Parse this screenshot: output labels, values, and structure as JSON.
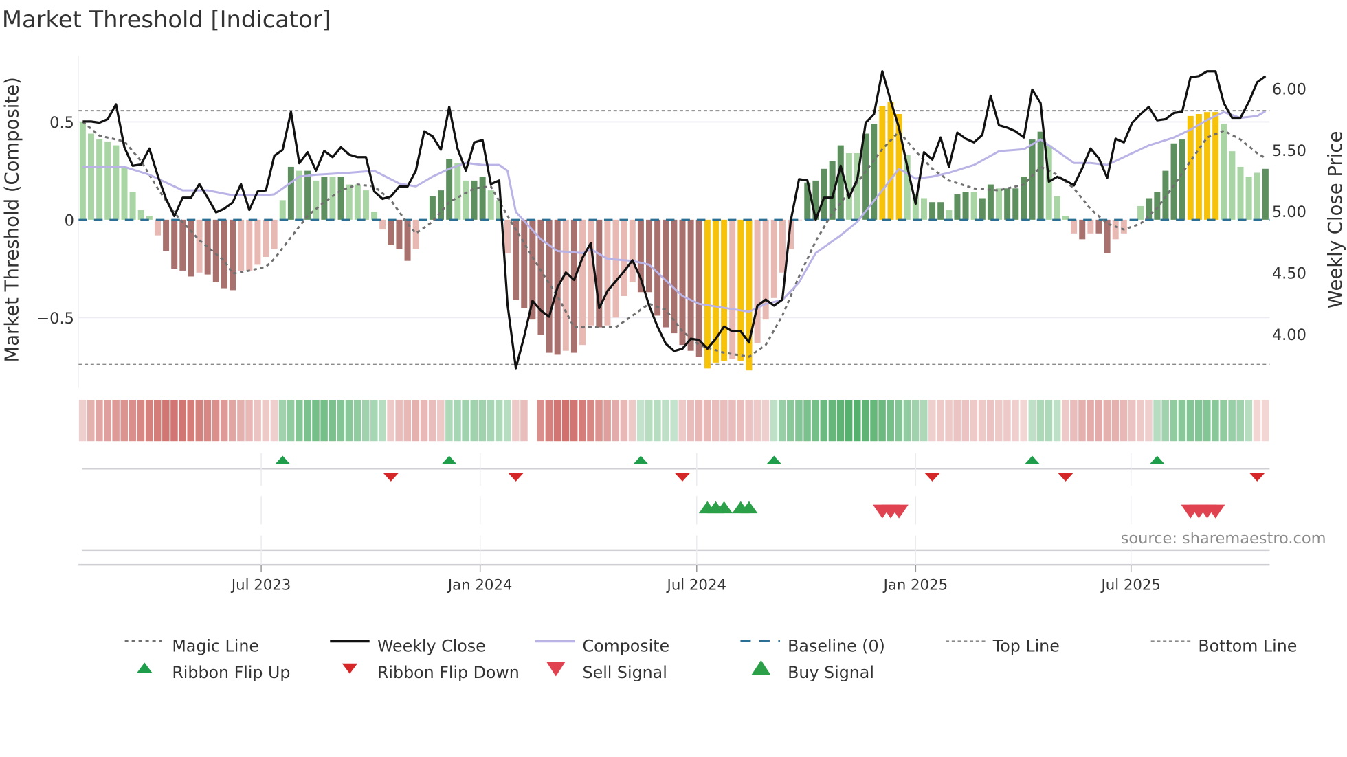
{
  "title": "Market Threshold [Indicator]",
  "source": "source: sharemaestro.com",
  "chart_data": {
    "type": "bar",
    "title": "Market Threshold [Indicator]",
    "ylabel": "Market Threshold (Composite)",
    "ylabel_right": "Weekly Close Price",
    "x_start_date": "2023-02-01",
    "x_step_days": 7,
    "ylim": [
      -0.83,
      0.84
    ],
    "ylim_right": [
      3.6,
      6.3
    ],
    "top_line": 0.557,
    "bottom_line": -0.74,
    "baseline": 0,
    "grid": true,
    "legend_position": "bottom",
    "left_ticks": [
      {
        "v": 0.5,
        "label": "0.5"
      },
      {
        "v": 0,
        "label": "0"
      },
      {
        "v": -0.5,
        "label": "−0.5"
      }
    ],
    "right_ticks": [
      {
        "v": 6.0,
        "label": "6.00"
      },
      {
        "v": 5.5,
        "label": "5.50"
      },
      {
        "v": 5.0,
        "label": "5.00"
      },
      {
        "v": 4.5,
        "label": "4.50"
      },
      {
        "v": 4.0,
        "label": "4.00"
      }
    ],
    "x_ticks": [
      {
        "label": "Jul 2023",
        "date": "2023-07-01"
      },
      {
        "label": "Jan 2024",
        "date": "2024-01-01"
      },
      {
        "label": "Jul 2024",
        "date": "2024-07-01"
      },
      {
        "label": "Jan 2025",
        "date": "2025-01-01"
      },
      {
        "label": "Jul 2025",
        "date": "2025-07-01"
      }
    ],
    "colors": {
      "L": "#a8d5a3",
      "D": "#5e8f5e",
      "l": "#e8b8b3",
      "d": "#a8716d",
      "Y": "#f7c20a",
      "close": "#111111",
      "composite": "#b9b3e6",
      "magic": "#707070",
      "baseline": "#2b6f94",
      "refline": "#8a8a8a",
      "ribbon_green": "#34a050",
      "ribbon_red": "#c85a55",
      "flip_up": "#1e9e4a",
      "flip_down": "#d62728",
      "buy": "#2ca048",
      "sell": "#e0434f"
    },
    "histogram": {
      "category_codes": "LLLLLLLLLlddddlddddlllllLDLDLDLDLLLLldddlLDDDLLDDLLlddddddldlldllllddddddddYYYlYYllllllDDDDDLLDDYYYLLLDDLDDLDDLDDDDDLLLldlddllLLDDDDDYYYYLLLLLD",
      "values": [
        0.5,
        0.44,
        0.41,
        0.4,
        0.38,
        0.27,
        0.14,
        0.05,
        0.02,
        -0.08,
        -0.16,
        -0.25,
        -0.26,
        -0.29,
        -0.27,
        -0.28,
        -0.32,
        -0.35,
        -0.36,
        -0.26,
        -0.26,
        -0.23,
        -0.19,
        -0.15,
        0.1,
        0.27,
        0.25,
        0.25,
        0.2,
        0.22,
        0.22,
        0.22,
        0.18,
        0.18,
        0.15,
        0.04,
        -0.05,
        -0.13,
        -0.15,
        -0.21,
        -0.15,
        0.0,
        0.12,
        0.15,
        0.31,
        0.29,
        0.2,
        0.2,
        0.22,
        0.15,
        0.1,
        -0.17,
        -0.41,
        -0.45,
        -0.51,
        -0.59,
        -0.68,
        -0.69,
        -0.67,
        -0.68,
        -0.64,
        -0.54,
        -0.55,
        -0.54,
        -0.5,
        -0.39,
        -0.32,
        -0.37,
        -0.37,
        -0.49,
        -0.55,
        -0.58,
        -0.64,
        -0.67,
        -0.7,
        -0.76,
        -0.73,
        -0.72,
        -0.71,
        -0.72,
        -0.77,
        -0.63,
        -0.51,
        -0.4,
        -0.27,
        -0.15,
        0.0,
        0.19,
        0.2,
        0.26,
        0.3,
        0.38,
        0.34,
        0.34,
        0.44,
        0.49,
        0.58,
        0.6,
        0.54,
        0.33,
        0.13,
        0.11,
        0.09,
        0.09,
        0.05,
        0.13,
        0.14,
        0.14,
        0.11,
        0.18,
        0.16,
        0.16,
        0.16,
        0.22,
        0.41,
        0.45,
        0.38,
        0.12,
        0.02,
        -0.07,
        -0.1,
        -0.07,
        -0.07,
        -0.17,
        -0.1,
        -0.07,
        0.0,
        0.07,
        0.11,
        0.14,
        0.25,
        0.39,
        0.41,
        0.53,
        0.54,
        0.55,
        0.55,
        0.49,
        0.35,
        0.27,
        0.22,
        0.24,
        0.26
      ]
    },
    "series": [
      {
        "name": "Weekly Close",
        "axis": "right",
        "values": [
          5.73,
          5.73,
          5.72,
          5.75,
          5.87,
          5.52,
          5.37,
          5.38,
          5.51,
          5.29,
          5.1,
          4.96,
          5.11,
          5.11,
          5.22,
          5.11,
          4.99,
          5.02,
          5.07,
          5.22,
          5.01,
          5.16,
          5.17,
          5.45,
          5.5,
          5.81,
          5.39,
          5.48,
          5.33,
          5.49,
          5.44,
          5.52,
          5.46,
          5.44,
          5.44,
          5.16,
          5.1,
          5.12,
          5.2,
          5.2,
          5.33,
          5.65,
          5.61,
          5.5,
          5.85,
          5.51,
          5.33,
          5.56,
          5.58,
          5.22,
          5.25,
          4.24,
          3.72,
          3.98,
          4.27,
          4.19,
          4.14,
          4.38,
          4.5,
          4.44,
          4.62,
          4.74,
          4.21,
          4.35,
          4.43,
          4.51,
          4.6,
          4.45,
          4.23,
          4.06,
          3.92,
          3.86,
          3.88,
          3.96,
          3.95,
          3.88,
          3.96,
          4.06,
          4.02,
          4.02,
          3.93,
          4.23,
          4.28,
          4.23,
          4.28,
          4.92,
          5.26,
          5.25,
          4.93,
          5.11,
          5.11,
          5.37,
          5.11,
          5.26,
          5.72,
          5.79,
          6.14,
          5.9,
          5.68,
          5.36,
          5.06,
          5.48,
          5.42,
          5.6,
          5.36,
          5.64,
          5.59,
          5.56,
          5.62,
          5.94,
          5.7,
          5.68,
          5.65,
          5.6,
          5.99,
          5.88,
          5.24,
          5.28,
          5.25,
          5.21,
          5.35,
          5.51,
          5.43,
          5.27,
          5.59,
          5.56,
          5.72,
          5.79,
          5.85,
          5.74,
          5.75,
          5.8,
          5.81,
          6.09,
          6.1,
          6.14,
          6.14,
          5.88,
          5.76,
          5.76,
          5.89,
          6.05,
          6.1
        ]
      },
      {
        "name": "Composite",
        "axis": "left",
        "points": [
          [
            0,
            0.27
          ],
          [
            5,
            0.27
          ],
          [
            8,
            0.23
          ],
          [
            12,
            0.15
          ],
          [
            15,
            0.15
          ],
          [
            18,
            0.125
          ],
          [
            22,
            0.125
          ],
          [
            23,
            0.13
          ],
          [
            26,
            0.22
          ],
          [
            28,
            0.23
          ],
          [
            32,
            0.24
          ],
          [
            35,
            0.25
          ],
          [
            38,
            0.185
          ],
          [
            40,
            0.17
          ],
          [
            42,
            0.22
          ],
          [
            44,
            0.26
          ],
          [
            46,
            0.29
          ],
          [
            48,
            0.28
          ],
          [
            50,
            0.28
          ],
          [
            51,
            0.25
          ],
          [
            52,
            0.04
          ],
          [
            55,
            -0.1
          ],
          [
            57,
            -0.16
          ],
          [
            60,
            -0.17
          ],
          [
            61,
            -0.15
          ],
          [
            63,
            -0.2
          ],
          [
            66,
            -0.21
          ],
          [
            68,
            -0.23
          ],
          [
            70,
            -0.31
          ],
          [
            72,
            -0.39
          ],
          [
            74,
            -0.43
          ],
          [
            77,
            -0.45
          ],
          [
            80,
            -0.47
          ],
          [
            82,
            -0.43
          ],
          [
            84,
            -0.41
          ],
          [
            86,
            -0.32
          ],
          [
            88,
            -0.17
          ],
          [
            91,
            -0.08
          ],
          [
            93,
            -0.01
          ],
          [
            96,
            0.15
          ],
          [
            98,
            0.26
          ],
          [
            100,
            0.21
          ],
          [
            102,
            0.22
          ],
          [
            104,
            0.24
          ],
          [
            107,
            0.28
          ],
          [
            110,
            0.35
          ],
          [
            113,
            0.36
          ],
          [
            115,
            0.41
          ],
          [
            118,
            0.32
          ],
          [
            119,
            0.29
          ],
          [
            121,
            0.29
          ],
          [
            123,
            0.28
          ],
          [
            126,
            0.34
          ],
          [
            128,
            0.38
          ],
          [
            131,
            0.42
          ],
          [
            133,
            0.46
          ],
          [
            135,
            0.51
          ],
          [
            137,
            0.55
          ],
          [
            139,
            0.52
          ],
          [
            141,
            0.53
          ],
          [
            142,
            0.555
          ]
        ]
      },
      {
        "name": "Magic Line",
        "axis": "left",
        "points": [
          [
            0,
            0.5
          ],
          [
            2,
            0.43
          ],
          [
            5,
            0.4
          ],
          [
            7,
            0.3
          ],
          [
            9,
            0.16
          ],
          [
            11,
            0.035
          ],
          [
            14,
            -0.105
          ],
          [
            17,
            -0.21
          ],
          [
            18,
            -0.275
          ],
          [
            20,
            -0.26
          ],
          [
            22,
            -0.24
          ],
          [
            23,
            -0.2
          ],
          [
            25,
            -0.09
          ],
          [
            27,
            0.02
          ],
          [
            29,
            0.09
          ],
          [
            31,
            0.15
          ],
          [
            33,
            0.18
          ],
          [
            35,
            0.17
          ],
          [
            37,
            0.1
          ],
          [
            39,
            -0.02
          ],
          [
            40,
            -0.07
          ],
          [
            42,
            -0.01
          ],
          [
            44,
            0.09
          ],
          [
            47,
            0.16
          ],
          [
            49,
            0.17
          ],
          [
            51,
            0.02
          ],
          [
            53,
            -0.12
          ],
          [
            55,
            -0.26
          ],
          [
            57,
            -0.39
          ],
          [
            59,
            -0.55
          ],
          [
            62,
            -0.55
          ],
          [
            64,
            -0.55
          ],
          [
            66,
            -0.49
          ],
          [
            68,
            -0.43
          ],
          [
            70,
            -0.46
          ],
          [
            72,
            -0.57
          ],
          [
            74,
            -0.64
          ],
          [
            77,
            -0.68
          ],
          [
            80,
            -0.7
          ],
          [
            82,
            -0.64
          ],
          [
            84,
            -0.49
          ],
          [
            86,
            -0.29
          ],
          [
            88,
            -0.11
          ],
          [
            90,
            0.035
          ],
          [
            93,
            0.19
          ],
          [
            96,
            0.36
          ],
          [
            98,
            0.45
          ],
          [
            100,
            0.35
          ],
          [
            102,
            0.26
          ],
          [
            104,
            0.2
          ],
          [
            107,
            0.16
          ],
          [
            110,
            0.15
          ],
          [
            113,
            0.18
          ],
          [
            115,
            0.27
          ],
          [
            117,
            0.23
          ],
          [
            119,
            0.16
          ],
          [
            121,
            0.055
          ],
          [
            123,
            -0.02
          ],
          [
            125,
            -0.05
          ],
          [
            127,
            -0.02
          ],
          [
            129,
            0.06
          ],
          [
            131,
            0.175
          ],
          [
            133,
            0.3
          ],
          [
            135,
            0.42
          ],
          [
            137,
            0.455
          ],
          [
            139,
            0.41
          ],
          [
            141,
            0.34
          ],
          [
            142,
            0.315
          ]
        ]
      }
    ],
    "ribbon": [
      -0.15,
      -0.4,
      -0.5,
      -0.55,
      -0.6,
      -0.65,
      -0.7,
      -0.75,
      -0.8,
      -0.85,
      -0.9,
      -0.9,
      -0.9,
      -0.85,
      -0.8,
      -0.75,
      -0.7,
      -0.6,
      -0.5,
      -0.4,
      -0.35,
      -0.25,
      -0.2,
      -0.15,
      0.4,
      0.5,
      0.6,
      0.65,
      0.7,
      0.7,
      0.65,
      0.6,
      0.55,
      0.5,
      0.4,
      0.35,
      0.25,
      -0.2,
      -0.3,
      -0.35,
      -0.4,
      -0.35,
      -0.3,
      -0.2,
      0.3,
      0.35,
      0.4,
      0.4,
      0.4,
      0.35,
      0.3,
      0.25,
      -0.2,
      -0.3,
      null,
      -0.7,
      -0.8,
      -0.9,
      -0.95,
      -0.9,
      -0.85,
      -0.75,
      -0.65,
      -0.55,
      -0.45,
      -0.35,
      -0.2,
      0.15,
      0.25,
      0.25,
      0.2,
      0.15,
      -0.2,
      -0.3,
      -0.35,
      -0.35,
      -0.3,
      -0.3,
      -0.3,
      -0.3,
      -0.25,
      -0.2,
      -0.15,
      0.2,
      0.45,
      0.55,
      0.6,
      0.65,
      0.7,
      0.75,
      0.8,
      0.85,
      0.9,
      0.9,
      0.85,
      0.8,
      0.75,
      0.7,
      0.6,
      0.5,
      0.4,
      0.3,
      -0.15,
      -0.2,
      -0.2,
      -0.25,
      -0.25,
      -0.2,
      -0.2,
      -0.25,
      -0.2,
      -0.2,
      -0.15,
      -0.1,
      0.2,
      0.3,
      0.3,
      0.2,
      -0.2,
      -0.3,
      -0.4,
      -0.45,
      -0.45,
      -0.4,
      -0.4,
      -0.35,
      -0.25,
      -0.2,
      -0.15,
      0.25,
      0.4,
      0.5,
      0.55,
      0.6,
      0.6,
      0.6,
      0.55,
      0.5,
      0.45,
      0.4,
      0.25,
      -0.1,
      -0.1
    ],
    "signals": {
      "ribbon_flip_up": [
        24,
        44,
        67,
        83,
        114,
        129
      ],
      "ribbon_flip_down": [
        37,
        52,
        72,
        102,
        118,
        141
      ],
      "buy": [
        75,
        76,
        77,
        79,
        80
      ],
      "sell": [
        96,
        97,
        98,
        133,
        134,
        135,
        136
      ]
    },
    "legend": [
      {
        "label": "Magic Line",
        "key": "magic"
      },
      {
        "label": "Weekly Close",
        "key": "close"
      },
      {
        "label": "Composite",
        "key": "composite"
      },
      {
        "label": "Baseline (0)",
        "key": "baseline"
      },
      {
        "label": "Top Line",
        "key": "top"
      },
      {
        "label": "Bottom Line",
        "key": "bottom"
      },
      {
        "label": "Ribbon Flip Up",
        "key": "flip_up"
      },
      {
        "label": "Ribbon Flip Down",
        "key": "flip_down"
      },
      {
        "label": "Sell Signal",
        "key": "sell"
      },
      {
        "label": "Buy Signal",
        "key": "buy"
      }
    ]
  }
}
